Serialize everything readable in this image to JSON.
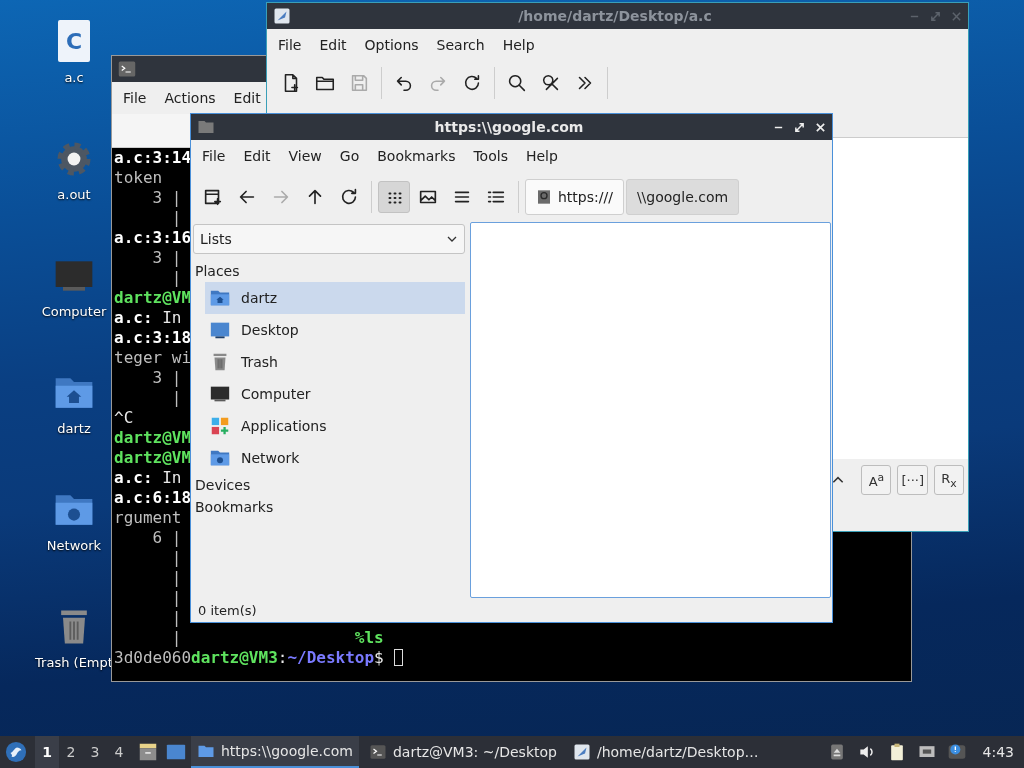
{
  "desktop_icons": [
    {
      "label": "a.c",
      "kind": "c-source",
      "glyph": "C"
    },
    {
      "label": "a.out",
      "kind": "gear"
    },
    {
      "label": "Computer",
      "kind": "computer"
    },
    {
      "label": "dartz",
      "kind": "home-folder"
    },
    {
      "label": "Network",
      "kind": "network-folder"
    },
    {
      "label": "Trash (Empt",
      "kind": "trash"
    }
  ],
  "terminal": {
    "menu": [
      "File",
      "Actions",
      "Edit"
    ],
    "cursor": true,
    "lines": [
      {
        "parts": [
          {
            "kind": "bold",
            "text": "a.c:3:14"
          }
        ]
      },
      {
        "parts": [
          {
            "kind": "dim",
            "text": "token"
          }
        ]
      },
      {
        "parts": [
          {
            "kind": "dim",
            "text": "    3 |"
          }
        ]
      },
      {
        "parts": [
          {
            "kind": "dim",
            "text": "      |"
          }
        ]
      },
      {
        "parts": [
          {
            "kind": "bold",
            "text": "a.c:3:16"
          }
        ]
      },
      {
        "parts": [
          {
            "kind": "dim",
            "text": "    3 |"
          }
        ]
      },
      {
        "parts": [
          {
            "kind": "dim",
            "text": "      |"
          }
        ]
      },
      {
        "parts": [
          {
            "kind": "green",
            "text": "dartz@VM"
          }
        ]
      },
      {
        "parts": [
          {
            "kind": "bold",
            "text": "a.c:"
          },
          {
            "kind": "plain",
            "text": " In"
          }
        ]
      },
      {
        "parts": [
          {
            "kind": "bold",
            "text": "a.c:3:18"
          }
        ]
      },
      {
        "parts": [
          {
            "kind": "dim",
            "text": "teger wi"
          }
        ]
      },
      {
        "parts": [
          {
            "kind": "dim",
            "text": "    3 |"
          }
        ]
      },
      {
        "parts": [
          {
            "kind": "dim",
            "text": "      |"
          }
        ]
      },
      {
        "parts": [
          {
            "kind": "plain",
            "text": "^C"
          }
        ]
      },
      {
        "parts": [
          {
            "kind": "green",
            "text": "dartz@VM"
          }
        ]
      },
      {
        "parts": [
          {
            "kind": "green",
            "text": "dartz@VM"
          }
        ]
      },
      {
        "parts": [
          {
            "kind": "bold",
            "text": "a.c:"
          },
          {
            "kind": "plain",
            "text": " In"
          }
        ]
      },
      {
        "parts": [
          {
            "kind": "bold",
            "text": "a.c:6:18"
          }
        ]
      },
      {
        "parts": [
          {
            "kind": "dim",
            "text": "rgument"
          }
        ]
      },
      {
        "parts": [
          {
            "kind": "dim",
            "text": "    6 |"
          }
        ]
      },
      {
        "parts": [
          {
            "kind": "dim",
            "text": "      |"
          }
        ]
      },
      {
        "parts": [
          {
            "kind": "dim",
            "text": "      |"
          }
        ]
      },
      {
        "parts": [
          {
            "kind": "dim",
            "text": "      |"
          }
        ]
      },
      {
        "parts": [
          {
            "kind": "dim",
            "text": "      |"
          }
        ]
      },
      {
        "parts": [
          {
            "kind": "dim",
            "text": "      |"
          }
        ],
        "aside": {
          "kind": "green",
          "text": "%ls"
        }
      },
      {
        "parts": [
          {
            "kind": "dim",
            "text": "3d0de060"
          },
          {
            "kind": "green",
            "text": "dartz@VM3"
          },
          {
            "kind": "plain",
            "text": ":"
          },
          {
            "kind": "blue",
            "text": "~/Desktop"
          },
          {
            "kind": "plain",
            "text": "$"
          }
        ]
      }
    ]
  },
  "editor": {
    "title": "/home/dartz/Desktop/a.c",
    "menu": [
      "File",
      "Edit",
      "Options",
      "Search",
      "Help"
    ],
    "toolbar": [
      [
        {
          "kind": "new-document",
          "disabled": false
        },
        {
          "kind": "open",
          "disabled": false
        },
        {
          "kind": "save",
          "disabled": true
        }
      ],
      [
        {
          "kind": "undo",
          "disabled": false
        },
        {
          "kind": "redo",
          "disabled": true
        },
        {
          "kind": "reload",
          "disabled": false
        }
      ],
      [
        {
          "kind": "search",
          "disabled": false
        },
        {
          "kind": "find-replace",
          "disabled": false
        },
        {
          "kind": "more",
          "disabled": false
        }
      ]
    ],
    "search_options": [
      "A$^{a}$",
      "[···]",
      "R$_{x}$"
    ]
  },
  "file_manager": {
    "title": "https:\\\\google.com",
    "menu": [
      "File",
      "Edit",
      "View",
      "Go",
      "Bookmarks",
      "Tools",
      "Help"
    ],
    "toolbar": [
      [
        {
          "kind": "new-tab",
          "disabled": false
        },
        {
          "kind": "back",
          "disabled": false
        },
        {
          "kind": "forward",
          "disabled": true
        },
        {
          "kind": "up",
          "disabled": false
        },
        {
          "kind": "reload",
          "disabled": false
        }
      ],
      [
        {
          "kind": "icon-view",
          "disabled": false,
          "selected": true
        },
        {
          "kind": "thumbnail",
          "disabled": false,
          "selected": false
        },
        {
          "kind": "compact",
          "disabled": false,
          "selected": false
        },
        {
          "kind": "detailed",
          "disabled": false,
          "selected": false
        }
      ]
    ],
    "path": [
      {
        "label": "https:///",
        "kind": "root",
        "selected": false
      },
      {
        "label": "\\\\google.com",
        "kind": "dir",
        "selected": true
      }
    ],
    "side_pane_mode": "Lists",
    "sections": [
      {
        "heading": "Places",
        "items": [
          {
            "label": "dartz",
            "kind": "home-folder",
            "selected": true
          },
          {
            "label": "Desktop",
            "kind": "desktop",
            "selected": false
          },
          {
            "label": "Trash",
            "kind": "trash",
            "selected": false
          },
          {
            "label": "Computer",
            "kind": "computer",
            "selected": false
          },
          {
            "label": "Applications",
            "kind": "applications",
            "selected": false
          },
          {
            "label": "Network",
            "kind": "network-folder",
            "selected": false
          }
        ]
      },
      {
        "heading": "Devices"
      },
      {
        "heading": "Bookmarks"
      }
    ],
    "status": "0 item(s)"
  },
  "taskbar": {
    "workspaces": [
      {
        "label": "1",
        "selected": true
      },
      {
        "label": "2",
        "selected": false
      },
      {
        "label": "3",
        "selected": false
      },
      {
        "label": "4",
        "selected": false
      }
    ],
    "tasks": [
      {
        "label": "https:\\\\google.com",
        "kind": "folder",
        "selected": true
      },
      {
        "label": "dartz@VM3: ~/Desktop",
        "kind": "terminal",
        "selected": false
      },
      {
        "label": "/home/dartz/Desktop…",
        "kind": "editor",
        "selected": false
      }
    ],
    "clock": "4:43"
  }
}
